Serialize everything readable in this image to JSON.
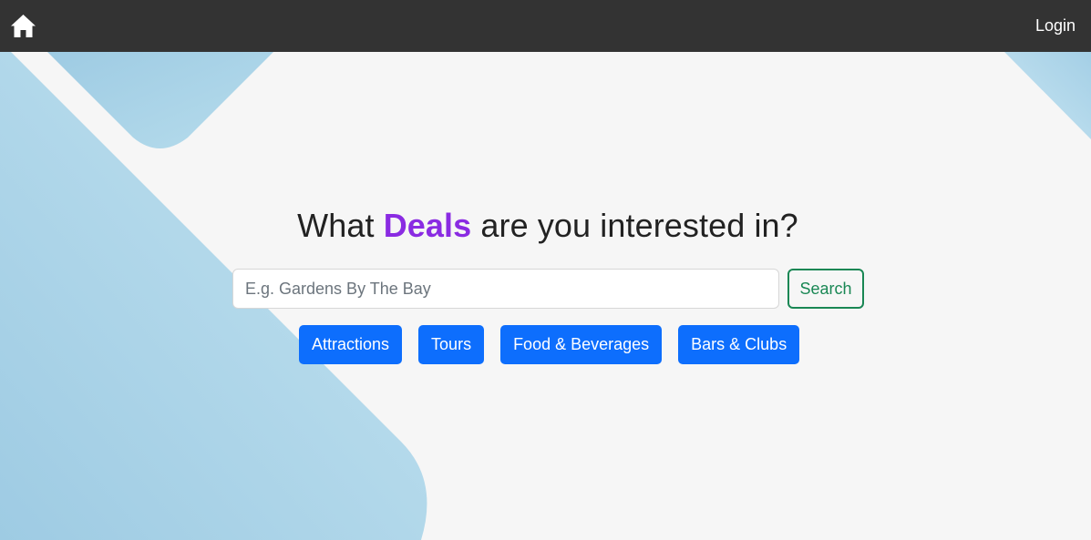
{
  "nav": {
    "home_icon": "home-icon",
    "login_label": "Login"
  },
  "hero": {
    "title_before": "What ",
    "title_accent": "Deals",
    "title_after": " are you interested in?"
  },
  "search": {
    "placeholder": "E.g. Gardens By The Bay",
    "value": "",
    "button_label": "Search"
  },
  "categories": [
    {
      "label": "Attractions"
    },
    {
      "label": "Tours"
    },
    {
      "label": "Food & Beverages"
    },
    {
      "label": "Bars & Clubs"
    }
  ],
  "colors": {
    "navbar": "#333333",
    "background": "#f6f6f6",
    "accent_purple": "#8a2be2",
    "primary_blue": "#0d6efd",
    "success_green": "#198754",
    "decor_blue": "#a9d6ea"
  }
}
